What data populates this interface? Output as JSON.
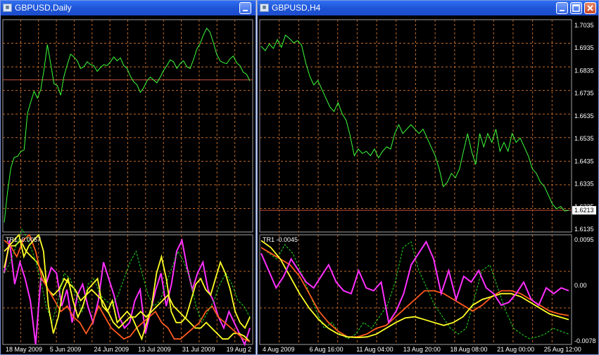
{
  "windows": [
    {
      "title": "GBPUSD,Daily",
      "icons": [
        "chart-window-icon",
        "minimize-icon"
      ],
      "chart_data": [
        {
          "type": "line",
          "series": [
            {
              "values": [
                1.515,
                1.547,
                1.572,
                1.583,
                1.584,
                1.589,
                1.591,
                1.629,
                1.641,
                1.652,
                1.645,
                1.654,
                1.675,
                1.701,
                1.681,
                1.66,
                1.658,
                1.648,
                1.668,
                1.68,
                1.691,
                1.688,
                1.684,
                1.676,
                1.678,
                1.683,
                1.68,
                1.679,
                1.673,
                1.677,
                1.68,
                1.679,
                1.683,
                1.688,
                1.684,
                1.687,
                1.679,
                1.676,
                1.668,
                1.662,
                1.659,
                1.651,
                1.656,
                1.663,
                1.667,
                1.664,
                1.661,
                1.667,
                1.674,
                1.679,
                1.685,
                1.683,
                1.676,
                1.681,
                1.684,
                1.678,
                1.676,
                1.685,
                1.696,
                1.702,
                1.711,
                1.718,
                1.714,
                1.703,
                1.691,
                1.684,
                1.682,
                1.681,
                1.686,
                1.689,
                1.682,
                1.679,
                1.672,
                1.67,
                1.663
              ]
            }
          ],
          "hlines": [
            1.6641
          ],
          "ylim": [
            1.505,
            1.727
          ],
          "grid": true
        },
        {
          "type": "line",
          "label": "TR1 -0.0057",
          "series": [
            {
              "values": [
                0.4,
                0.8,
                0.9,
                1.0,
                0.6,
                0.8,
                0.9,
                1.0,
                0.7,
                -0.3,
                -0.8,
                -0.5,
                0.0,
                0.2,
                -0.2,
                -0.5,
                -0.3,
                0.0,
                0.1,
                0.2,
                -0.3,
                -0.4,
                -0.2,
                -0.6,
                -0.5,
                -0.4,
                -0.5,
                -0.7,
                -0.9,
                -0.6,
                -0.3,
                0.3,
                0.6,
                0.2,
                -0.4,
                -0.6,
                -0.6,
                -0.5,
                -0.2,
                0.1,
                0.2,
                0.0,
                -0.1,
                0.2,
                0.5,
                0.3,
                0.0,
                -0.4,
                -0.6,
                -0.7,
                -0.5
              ]
            },
            {
              "values": [
                0.7,
                0.8,
                0.8,
                0.9,
                0.7,
                0.6,
                0.5,
                0.3,
                0.0,
                -0.1,
                0.0,
                0.2,
                0.1,
                0.0,
                -0.2,
                -0.1,
                0.0,
                -0.1,
                -0.2,
                -0.4,
                -0.6,
                -0.7,
                -0.6,
                -0.5,
                -0.5,
                -0.4,
                -0.5,
                -0.4,
                -0.3,
                -0.2,
                -0.1,
                -0.3,
                -0.4,
                -0.5,
                -0.6,
                -0.7,
                -0.7,
                -0.6,
                -0.7,
                -0.8,
                -0.9,
                -0.9,
                -0.8,
                -0.8,
                -0.85,
                -0.95
              ]
            },
            {
              "values": [
                0.3,
                0.5,
                0.8,
                1.1,
                0.9,
                0.6,
                0.2,
                -0.3,
                -0.6,
                -0.2,
                0.3,
                0.2,
                -0.1,
                -0.4,
                0.1,
                0.2,
                -0.1,
                -0.2,
                -0.3,
                -0.1,
                0.2,
                0.5,
                0.7,
                0.3,
                -0.1,
                -0.3,
                -0.2,
                0.1,
                0.4,
                0.7,
                0.5,
                0.2,
                -0.3,
                -0.6,
                -0.4,
                -0.2,
                0.1,
                0.3,
                0.1,
                -0.2,
                -0.3,
                -0.5
              ]
            },
            {
              "values": [
                0.9,
                0.8,
                0.6,
                0.9,
                1.0,
                0.7,
                0.2,
                0.0,
                -0.2,
                -0.4,
                -0.3,
                -0.5,
                -0.6,
                -0.8,
                -0.6,
                -0.3,
                -0.5,
                -0.7,
                -0.8,
                -0.9,
                -0.85,
                -0.7,
                -0.6,
                -0.5,
                -0.4,
                -0.6,
                -0.7,
                -0.9,
                -0.9,
                -0.8,
                -0.7,
                -0.6,
                -0.4,
                -0.3,
                -0.5,
                -0.6,
                -0.7,
                -0.8,
                -0.9,
                -0.95
              ]
            },
            {
              "values": [
                0.3,
                0.9,
                0.1,
                0.5,
                0.2,
                -0.2,
                -1.0,
                0.2,
                0.1,
                0.4,
                0.3,
                -0.3,
                0.0,
                -0.6,
                -0.1,
                0.1,
                -0.3,
                -0.6,
                -0.2,
                0.5,
                0.2,
                -0.1,
                -0.5,
                -0.7,
                -0.6,
                -0.2,
                0.0,
                -0.8,
                -0.4,
                0.0,
                0.3,
                -0.3,
                0.1,
                0.7,
                0.9,
                0.4,
                0.0,
                0.3,
                0.5,
                0.0,
                -0.2,
                -0.5,
                -0.7,
                -0.4,
                -0.6,
                -0.8,
                -1.0,
                -0.7
              ]
            }
          ],
          "ylim": [
            -1.0,
            1.0
          ],
          "grid": true
        }
      ],
      "x_tick_labels": [
        "18 May 2009",
        "5 Jun 2009",
        "24 Jun 2009",
        "13 Jul 2009",
        "31 Jul 2009",
        "19 Aug 2"
      ]
    },
    {
      "title": "GBPUSD,H4",
      "icons": [
        "chart-window-icon",
        "minimize-icon",
        "maximize-icon",
        "close-icon"
      ],
      "chart_data": [
        {
          "type": "line",
          "series": [
            {
              "values": [
                1.6955,
                1.6935,
                1.6965,
                1.6945,
                1.6985,
                1.695,
                1.7005,
                1.699,
                1.697,
                1.698,
                1.696,
                1.688,
                1.682,
                1.678,
                1.68,
                1.676,
                1.672,
                1.668,
                1.666,
                1.67,
                1.665,
                1.662,
                1.655,
                1.646,
                1.649,
                1.647,
                1.648,
                1.646,
                1.649,
                1.645,
                1.648,
                1.65,
                1.649,
                1.656,
                1.66,
                1.656,
                1.658,
                1.66,
                1.658,
                1.656,
                1.658,
                1.654,
                1.65,
                1.646,
                1.64,
                1.632,
                1.634,
                1.638,
                1.636,
                1.64,
                1.648,
                1.656,
                1.648,
                1.642,
                1.656,
                1.65,
                1.656,
                1.652,
                1.658,
                1.648,
                1.652,
                1.648,
                1.656,
                1.652,
                1.654,
                1.65,
                1.646,
                1.64,
                1.638,
                1.634,
                1.632,
                1.628,
                1.624,
                1.622,
                1.623,
                1.621,
                1.6213
              ]
            }
          ],
          "hlines": [
            1.6213
          ],
          "last_price_label": "1.6213",
          "y_tick_labels": [
            "1.7035",
            "1.6935",
            "1.6835",
            "1.6735",
            "1.6635",
            "1.6535",
            "1.6435",
            "1.6335",
            "1.6235",
            "1.6135"
          ],
          "ylim": [
            1.6115,
            1.7075
          ],
          "grid": true
        },
        {
          "type": "line",
          "label": "TR1 -0.0045",
          "y_tick_labels": [
            "0.0095",
            "0.00",
            "-0.0078"
          ],
          "series": [
            {
              "values": [
                0.008,
                0.007,
                0.006,
                0.0085,
                0.007,
                0.004,
                0.0005,
                -0.003,
                -0.006,
                -0.005,
                -0.007,
                -0.0078,
                -0.007,
                -0.005,
                -0.006,
                -0.004,
                -0.002,
                0.002,
                0.008,
                0.009,
                0.004,
                0.001,
                -0.002,
                -0.004,
                -0.006,
                -0.007,
                -0.006,
                -0.001,
                0.004,
                0.005,
                0.001,
                -0.003,
                -0.006,
                -0.007,
                -0.0078,
                -0.0075,
                -0.007,
                -0.006,
                -0.0065,
                -0.007
              ]
            },
            {
              "values": [
                0.008,
                0.007,
                0.006,
                0.005,
                0.003,
                0.0,
                -0.003,
                -0.005,
                -0.0065,
                -0.0075,
                -0.0075,
                -0.007,
                -0.006,
                -0.0055,
                -0.004,
                -0.0025,
                -0.001,
                0.0005,
                0.0005,
                0.0,
                -0.001,
                -0.002,
                -0.003,
                -0.002,
                -0.0005,
                0.0005,
                0.0005,
                0.0,
                -0.001,
                -0.002,
                -0.003,
                -0.0035,
                -0.0038
              ]
            },
            {
              "values": [
                0.0092,
                0.008,
                0.006,
                0.003,
                0.0,
                -0.0025,
                -0.0045,
                -0.006,
                -0.007,
                -0.0075,
                -0.0076,
                -0.0075,
                -0.007,
                -0.006,
                -0.005,
                -0.0042,
                -0.004,
                -0.0045,
                -0.005,
                -0.0055,
                -0.005,
                -0.004,
                -0.002,
                -0.001,
                -0.0005,
                0.0,
                0.0,
                -0.0005,
                -0.0015,
                -0.0025,
                -0.0035,
                -0.004,
                -0.0045
              ]
            },
            {
              "values": [
                0.007,
                0.004,
                0.001,
                0.003,
                0.006,
                0.004,
                0.002,
                0.001,
                0.003,
                0.005,
                0.002,
                0.0005,
                0.0,
                0.004,
                0.001,
                0.0005,
                0.002,
                -0.005,
                -0.003,
                0.0,
                0.005,
                0.007,
                0.009,
                0.006,
                0.0,
                0.004,
                -0.001,
                0.003,
                0.002,
                0.004,
                0.001,
                0.0,
                -0.002,
                -0.0015,
                0.0,
                0.002,
                -0.001,
                -0.002,
                0.001,
                0.0,
                0.001,
                0.0005
              ]
            }
          ],
          "ylim": [
            -0.0088,
            0.0102
          ],
          "grid": true
        }
      ],
      "x_tick_labels": [
        "4 Aug 2009",
        "6 Aug 16:00",
        "11 Aug 04:00",
        "13 Aug 20:00",
        "18 Aug 08:00",
        "21 Aug 00:00",
        "25 Aug 12:00"
      ]
    }
  ],
  "colors": {
    "price": "#3cff3c",
    "grid": "#c06a28",
    "hline": "#c8503c",
    "magenta": "#ff30ff",
    "orange": "#ff5a1e",
    "yellow": "#ffff26",
    "green_dash": "#22dd22",
    "axis_text": "#ffffff",
    "separator": "#a0a0a0"
  }
}
